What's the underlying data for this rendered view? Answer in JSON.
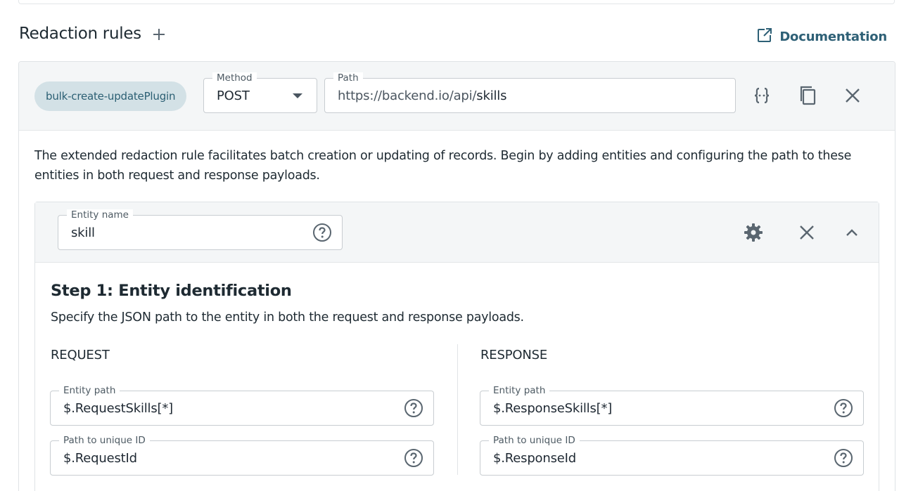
{
  "section": {
    "title": "Redaction rules",
    "documentation_label": "Documentation"
  },
  "rule": {
    "chip_label": "bulk-create-updatePlugin",
    "method": {
      "label": "Method",
      "value": "POST"
    },
    "path": {
      "label": "Path",
      "value_muted": "https://backend.io/api/",
      "value_main": "skills"
    },
    "description": "The extended redaction rule facilitates batch creation or updating of records. Begin by adding entities and configuring the path to these entities in both request and response payloads."
  },
  "entity": {
    "name_label": "Entity name",
    "name_value": "skill",
    "step_title": "Step 1: Entity identification",
    "step_desc": "Specify the JSON path to the entity in both the request and response payloads.",
    "request": {
      "title": "REQUEST",
      "entity_path_label": "Entity path",
      "entity_path_value": "$.RequestSkills[*]",
      "unique_id_label": "Path to unique ID",
      "unique_id_value": "$.RequestId"
    },
    "response": {
      "title": "RESPONSE",
      "entity_path_label": "Entity path",
      "entity_path_value": "$.ResponseSkills[*]",
      "unique_id_label": "Path to unique ID",
      "unique_id_value": "$.ResponseId"
    }
  },
  "icons": {
    "add": "plus-icon",
    "documentation": "external-link-icon",
    "json": "curly-braces-icon",
    "copy": "copy-icon",
    "close": "close-icon",
    "help": "question-circle-icon",
    "settings": "gear-icon",
    "collapse": "chevron-up-icon",
    "dropdown": "caret-down-icon"
  },
  "colors": {
    "accent": "#2e6076",
    "chip_bg": "#d3e1e6",
    "header_bg": "#f4f6f7",
    "border": "#c8cdd1",
    "icon": "#5a6670"
  }
}
